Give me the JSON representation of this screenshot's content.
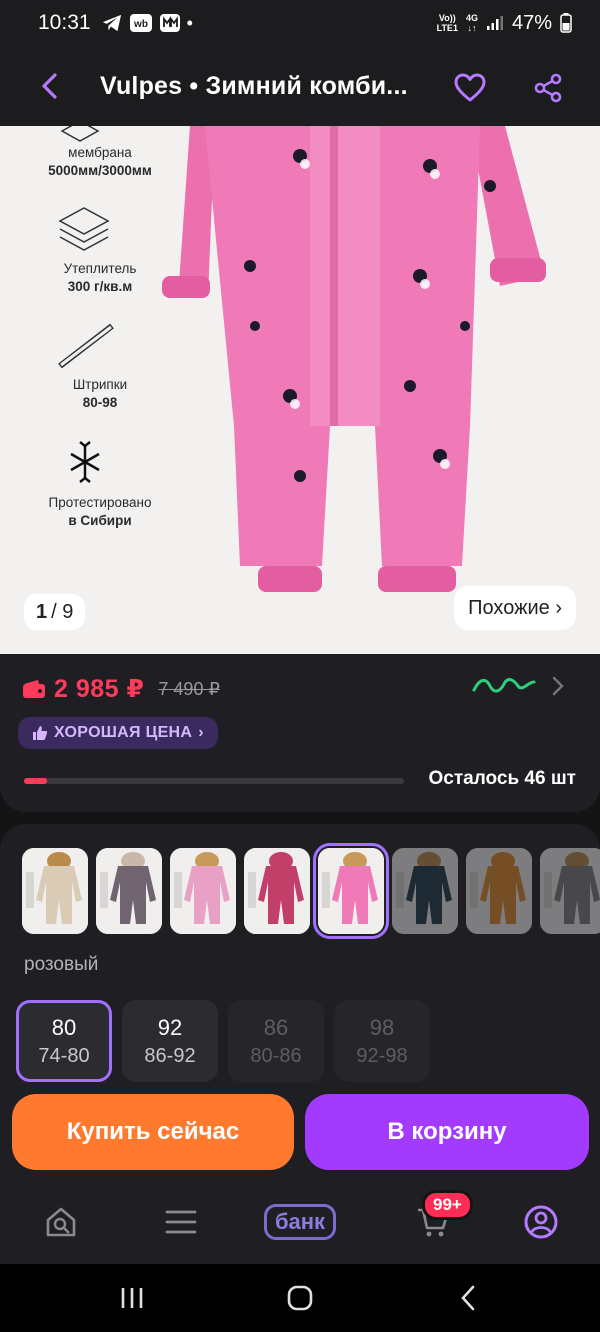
{
  "status_bar": {
    "time": "10:31",
    "dot": "•",
    "network_top": "Vo))",
    "network_bottom": "LTE1",
    "data_type": "4G",
    "battery": "47%"
  },
  "header": {
    "title": "Vulpes • Зимний комби..."
  },
  "gallery": {
    "features": [
      {
        "line1": "мембрана",
        "line2": "5000мм/3000мм",
        "icon": "membrane-icon"
      },
      {
        "line1": "Утеплитель",
        "line2": "300 г/кв.м",
        "icon": "layers-icon"
      },
      {
        "line1": "Штрипки",
        "line2": "80-98",
        "icon": "strap-icon"
      },
      {
        "line1": "Протестировано",
        "line2": "в Сибири",
        "icon": "snowflake-icon"
      }
    ],
    "counter_current": "1",
    "counter_total": "/ 9",
    "similar_label": "Похожие ›"
  },
  "price": {
    "current": "2 985 ₽",
    "old": "7 490 ₽",
    "good_price_label": "ХОРОШАЯ ЦЕНА",
    "stock_text": "Осталось 46 шт",
    "stock_fraction": 0.06,
    "accent": "#ff3b5c"
  },
  "options": {
    "color_name": "розовый",
    "thumbnails": [
      {
        "body": "#d9cbb6",
        "hood": "#b98a4a",
        "state": "normal"
      },
      {
        "body": "#6f6470",
        "hood": "#c9b8a8",
        "state": "normal"
      },
      {
        "body": "#e8a0c4",
        "hood": "#c89a5a",
        "state": "normal"
      },
      {
        "body": "#c23f6a",
        "hood": "#c23f6a",
        "state": "normal"
      },
      {
        "body": "#f07ab8",
        "hood": "#c89a5a",
        "state": "selected"
      },
      {
        "body": "#1c3a4a",
        "hood": "#b98a4a",
        "state": "dim"
      },
      {
        "body": "#e0892a",
        "hood": "#e0892a",
        "state": "dim"
      },
      {
        "body": "#7a7a80",
        "hood": "#b98a4a",
        "state": "dim"
      }
    ],
    "sizes": [
      {
        "size": "80",
        "ru": "74-80",
        "state": "selected"
      },
      {
        "size": "92",
        "ru": "86-92",
        "state": "available"
      },
      {
        "size": "86",
        "ru": "80-86",
        "state": "unavailable"
      },
      {
        "size": "98",
        "ru": "92-98",
        "state": "unavailable"
      }
    ],
    "buy_now": "Купить сейчас",
    "add_to_cart": "В корзину"
  },
  "bottom_nav": {
    "bank_label": "банк",
    "cart_badge": "99+"
  },
  "colors": {
    "purple": "#a33bff",
    "orange": "#ff7a2f"
  }
}
